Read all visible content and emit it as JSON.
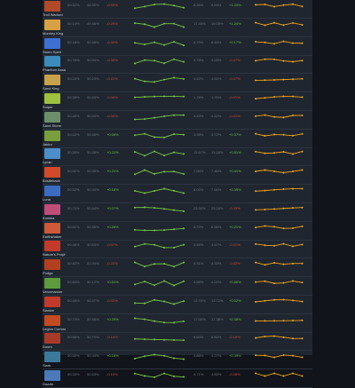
{
  "heroes": [
    {
      "name": "Troll Warlord",
      "win": "50.52%",
      "pick": "48.39%",
      "delta": "-0.99%",
      "pick2": "8.35%",
      "pick3": "9.53%",
      "delta2": "+1.23%",
      "color": "#b24a2a"
    },
    {
      "name": "Monkey King",
      "win": "50.14%",
      "pick": "49.48%",
      "delta": "-0.29%",
      "pick2": "17.45%",
      "pick3": "19.05%",
      "delta2": "+1.24%",
      "color": "#d8a244"
    },
    {
      "name": "Storm Spirit",
      "win": "50.18%",
      "pick": "50.58%",
      "delta": "-0.40%",
      "pick2": "8.79%",
      "pick3": "8.49%",
      "delta2": "+0.17%",
      "color": "#3e6fd2"
    },
    {
      "name": "Phantom Assassin",
      "win": "50.78%",
      "pick": "50.94%",
      "delta": "-0.38%",
      "pick2": "3.78%",
      "pick3": "3.33%",
      "delta2": "-0.37%",
      "color": "#3b8bbd"
    },
    {
      "name": "Sand King",
      "win": "50.24%",
      "pick": "50.23%",
      "delta": "-0.21%",
      "pick2": "4.42%",
      "pick3": "4.51%",
      "delta2": "-0.07%",
      "color": "#c7a24a"
    },
    {
      "name": "Sniper",
      "win": "50.38%",
      "pick": "50.43%",
      "delta": "-0.06%",
      "pick2": "1.78%",
      "pick3": "1.76%",
      "delta2": "-0.01%",
      "color": "#9fbf3f"
    },
    {
      "name": "Sand Storm",
      "win": "50.40%",
      "pick": "50.44%",
      "delta": "-0.04%",
      "pick2": "4.43%",
      "pick3": "4.42%",
      "delta2": "-0.01%",
      "color": "#6c8f6a"
    },
    {
      "name": "Jakiro",
      "win": "50.42%",
      "pick": "50.36%",
      "delta": "+0.06%",
      "pick2": "3.35%",
      "pick3": "3.72%",
      "delta2": "+0.37%",
      "color": "#7a9e3c"
    },
    {
      "name": "Lycan",
      "win": "50.50%",
      "pick": "50.28%",
      "delta": "+0.22%",
      "pick2": "12.67%",
      "pick3": "13.18%",
      "delta2": "+0.51%",
      "color": "#4d8dc9"
    },
    {
      "name": "Bristleback",
      "win": "50.51%",
      "pick": "50.30%",
      "delta": "+0.21%",
      "pick2": "7.05%",
      "pick3": "7.46%",
      "delta2": "+0.41%",
      "color": "#d24a2a"
    },
    {
      "name": "Luna",
      "win": "50.52%",
      "pick": "50.34%",
      "delta": "+0.18%",
      "pick2": "8.03%",
      "pick3": "7.68%",
      "delta2": "+0.35%",
      "color": "#3c6bc2"
    },
    {
      "name": "Kunkka",
      "win": "50.71%",
      "pick": "50.64%",
      "delta": "+0.07%",
      "pick2": "23.32%",
      "pick3": "23.34%",
      "delta2": "-0.03%",
      "color": "#c04c7a"
    },
    {
      "name": "Earthshaker",
      "win": "50.61%",
      "pick": "50.35%",
      "delta": "+0.26%",
      "pick2": "8.79%",
      "pick3": "8.58%",
      "delta2": "+0.21%",
      "color": "#ce5a3a"
    },
    {
      "name": "Nature's Prophet",
      "win": "50.46%",
      "pick": "50.53%",
      "delta": "-0.07%",
      "pick2": "3.46%",
      "pick3": "3.47%",
      "delta2": "-0.01%",
      "color": "#c43a2a"
    },
    {
      "name": "Pudge",
      "win": "50.82%",
      "pick": "51.04%",
      "delta": "-0.22%",
      "pick2": "4.31%",
      "pick3": "4.33%",
      "delta2": "-0.02%",
      "color": "#b24020"
    },
    {
      "name": "Venomancer",
      "win": "50.63%",
      "pick": "50.12%",
      "delta": "+0.51%",
      "pick2": "3.58%",
      "pick3": "4.24%",
      "delta2": "+0.66%",
      "color": "#5c9c3c"
    },
    {
      "name": "Slardar",
      "win": "50.45%",
      "pick": "50.47%",
      "delta": "-0.02%",
      "pick2": "12.70%",
      "pick3": "12.72%",
      "delta2": "+0.02%",
      "color": "#c23a2a"
    },
    {
      "name": "Legion Commander",
      "win": "50.73%",
      "pick": "50.48%",
      "delta": "+0.25%",
      "pick2": "17.00%",
      "pick3": "17.38%",
      "delta2": "+0.38%",
      "color": "#c44a20"
    },
    {
      "name": "Doom",
      "win": "50.56%",
      "pick": "50.70%",
      "delta": "-0.14%",
      "pick2": "8.60%",
      "pick3": "8.50%",
      "delta2": "-0.10%",
      "color": "#a83a2a"
    },
    {
      "name": "Slark",
      "win": "50.50%",
      "pick": "50.34%",
      "delta": "+0.16%",
      "pick2": "3.88%",
      "pick3": "4.27%",
      "delta2": "+0.39%",
      "color": "#3c7a9a"
    },
    {
      "name": "Dazzle",
      "win": "50.33%",
      "pick": "50.43%",
      "delta": "-0.10%",
      "pick2": "4.71%",
      "pick3": "4.65%",
      "delta2": "-0.06%",
      "color": "#4a7aba"
    }
  ],
  "spark_colors": {
    "green": "#7ac943",
    "orange": "#f0a418"
  }
}
